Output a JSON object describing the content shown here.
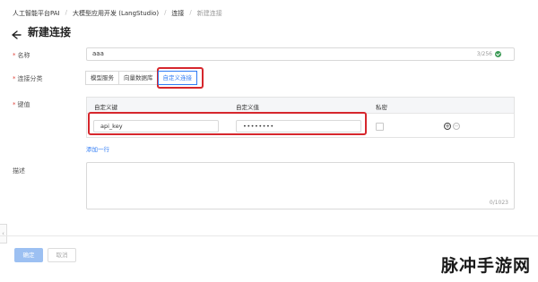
{
  "breadcrumb": {
    "items": [
      "人工智能平台PAI",
      "大模型应用开发 (LangStudio)",
      "连接",
      "新建连接"
    ],
    "separator": "/"
  },
  "header": {
    "title": "新建连接"
  },
  "form": {
    "name": {
      "label": "名称",
      "value": "aaa",
      "count": "3/256"
    },
    "category": {
      "label": "连接分类",
      "options": [
        "模型服务",
        "向量数据库",
        "自定义连接"
      ],
      "selected": "自定义连接"
    },
    "keyvalue": {
      "label": "键值",
      "columns": {
        "key": "自定义键",
        "value": "自定义值",
        "private": "私密"
      },
      "rows": [
        {
          "key": "api_key",
          "value": "••••••••",
          "private": false
        }
      ],
      "add_row": "添加一行"
    },
    "description": {
      "label": "描述",
      "value": "",
      "count": "0/1023"
    }
  },
  "footer": {
    "confirm": "确定",
    "cancel": "取消"
  },
  "watermark": "脉冲手游网",
  "colors": {
    "accent": "#2f7bf5",
    "highlight": "#d6272d",
    "success": "#3b9a55",
    "confirm_disabled": "#9cc0f2"
  }
}
